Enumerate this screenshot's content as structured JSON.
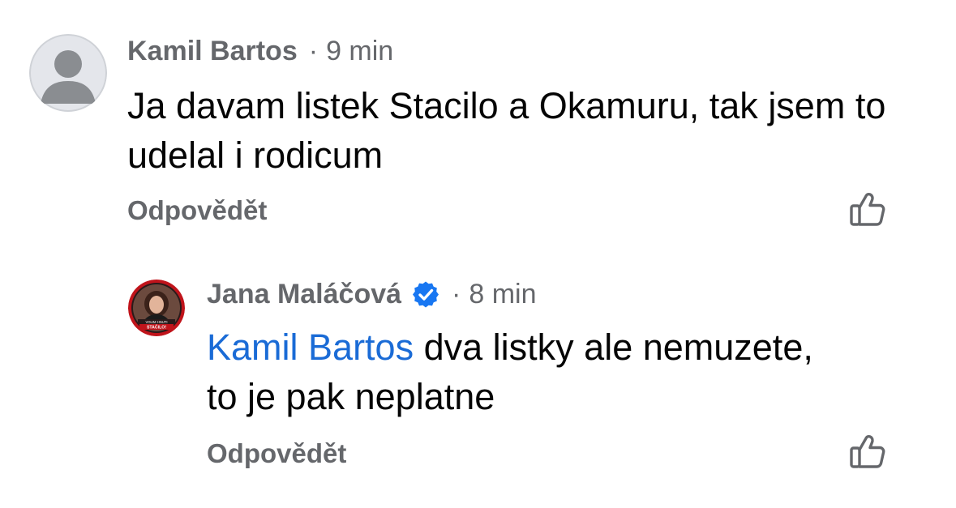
{
  "comments": [
    {
      "author": "Kamil Bartos",
      "separator": "·",
      "time": "9 min",
      "text": "Ja davam listek Stacilo a Okamuru, tak jsem to udelal i rodicum",
      "reply_label": "Odpovědět",
      "avatar_icon": "default-avatar-icon",
      "like_icon": "thumbs-up-icon"
    },
    {
      "author": "Jana Maláčová",
      "verified": true,
      "verified_icon": "verified-badge-icon",
      "separator": "·",
      "time": "8 min",
      "mention": "Kamil Bartos",
      "text": "dva listky ale nemuzete, to je pak neplatne",
      "reply_label": "Odpovědět",
      "avatar_badge_text": [
        "VOLIM HNUTI",
        "STAČILO!"
      ],
      "like_icon": "thumbs-up-icon"
    }
  ],
  "colors": {
    "meta_gray": "#65676b",
    "text": "#050505",
    "mention_blue": "#1a6bd6",
    "verified_blue": "#1877f2",
    "avatar_ring": "#c0141b"
  }
}
